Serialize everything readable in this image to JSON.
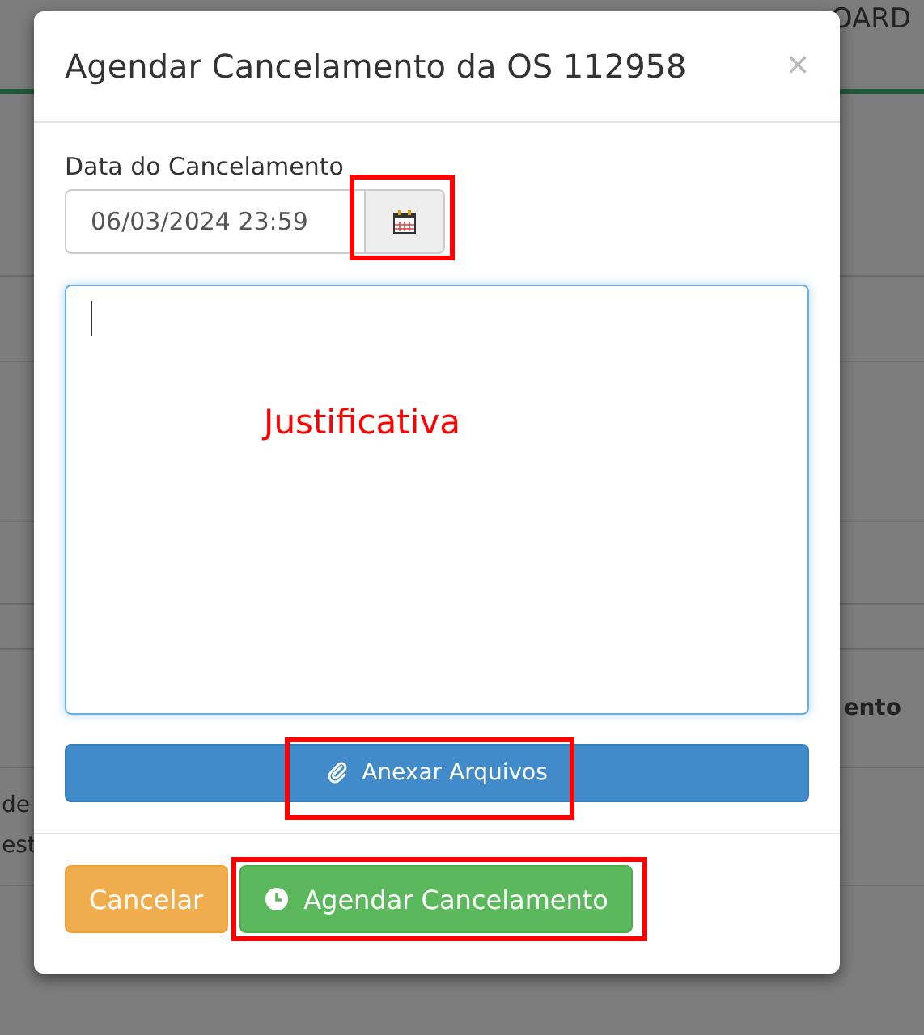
{
  "background": {
    "nav": [
      "OARD"
    ],
    "table_fragments": [
      "ento",
      "de",
      "est"
    ]
  },
  "modal": {
    "title": "Agendar Cancelamento da OS 112958",
    "close": "×",
    "date_field": {
      "label": "Data do Cancelamento",
      "value": "06/03/2024 23:59",
      "calendar_button_highlighted": true
    },
    "justification": {
      "focused": true,
      "annotation": "Justificativa"
    },
    "attach_button": {
      "label": "Anexar Arquivos",
      "highlighted": true
    },
    "footer_buttons": [
      {
        "kind": "cancel",
        "label": "Cancelar"
      },
      {
        "kind": "schedule",
        "label": "Agendar Cancelamento",
        "highlighted": true
      }
    ]
  }
}
